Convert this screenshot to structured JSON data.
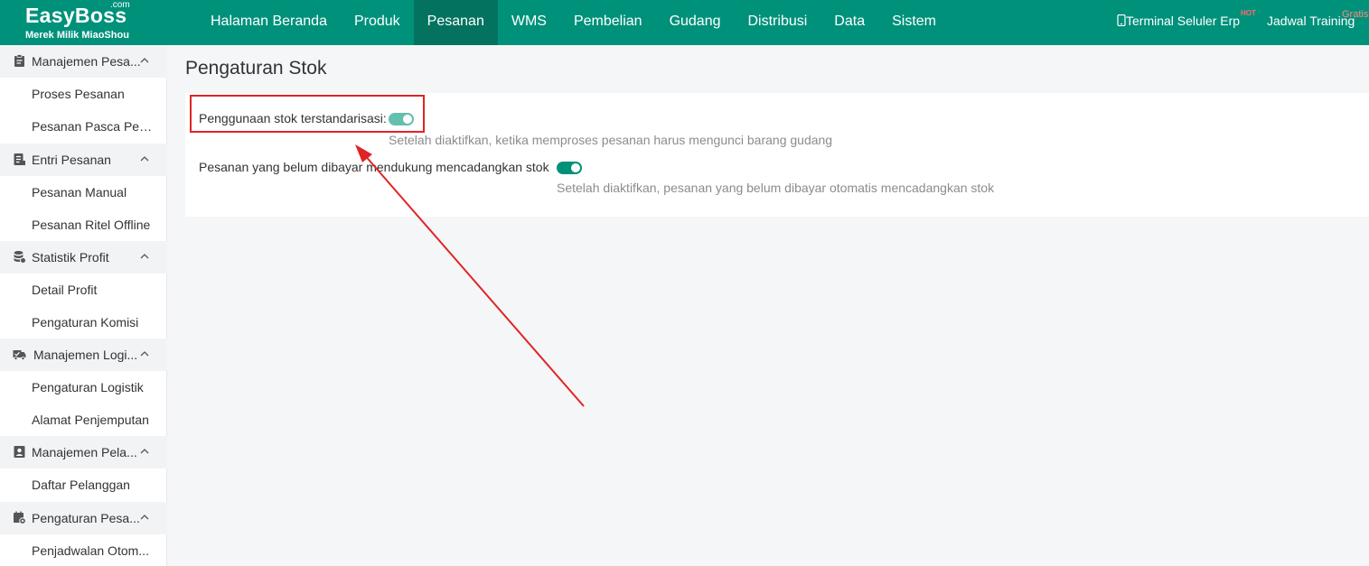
{
  "logo": {
    "brand": "EasyBoss",
    "com": ".com",
    "subtitle": "Merek Milik MiaoShou"
  },
  "nav": {
    "items": [
      "Halaman Beranda",
      "Produk",
      "Pesanan",
      "WMS",
      "Pembelian",
      "Gudang",
      "Distribusi",
      "Data",
      "Sistem"
    ],
    "active": "Pesanan",
    "terminal": "Terminal Seluler Erp",
    "hot_badge": "HOT",
    "training": "Jadwal Training",
    "gratis_badge": "Gratis"
  },
  "sidebar": {
    "groups": [
      {
        "label": "Manajemen Pesa...",
        "icon": "clipboard-icon",
        "items": [
          "Proses Pesanan",
          "Pesanan Pasca Penj..."
        ]
      },
      {
        "label": "Entri Pesanan",
        "icon": "document-list-icon",
        "items": [
          "Pesanan Manual",
          "Pesanan Ritel Offline"
        ]
      },
      {
        "label": "Statistik Profit",
        "icon": "coin-stack-icon",
        "items": [
          "Detail Profit",
          "Pengaturan Komisi"
        ]
      },
      {
        "label": "Manajemen Logi...",
        "icon": "truck-check-icon",
        "items": [
          "Pengaturan Logistik",
          "Alamat Penjemputan"
        ]
      },
      {
        "label": "Manajemen Pela...",
        "icon": "contact-card-icon",
        "items": [
          "Daftar Pelanggan"
        ]
      },
      {
        "label": "Pengaturan Pesa...",
        "icon": "settings-calendar-icon",
        "items": [
          "Penjadwalan Otom..."
        ]
      }
    ]
  },
  "main": {
    "title": "Pengaturan Stok",
    "settings": [
      {
        "label": "Penggunaan stok terstandarisasi:",
        "enabled": true,
        "hint": "Setelah diaktifkan, ketika memproses pesanan harus mengunci barang gudang"
      },
      {
        "label": "Pesanan yang belum dibayar mendukung mencadangkan stok",
        "enabled": true,
        "hint": "Setelah diaktifkan, pesanan yang belum dibayar otomatis mencadangkan stok"
      }
    ]
  },
  "colors": {
    "primary": "#00917b",
    "active_nav": "#03735f",
    "annotation": "#e02424"
  }
}
